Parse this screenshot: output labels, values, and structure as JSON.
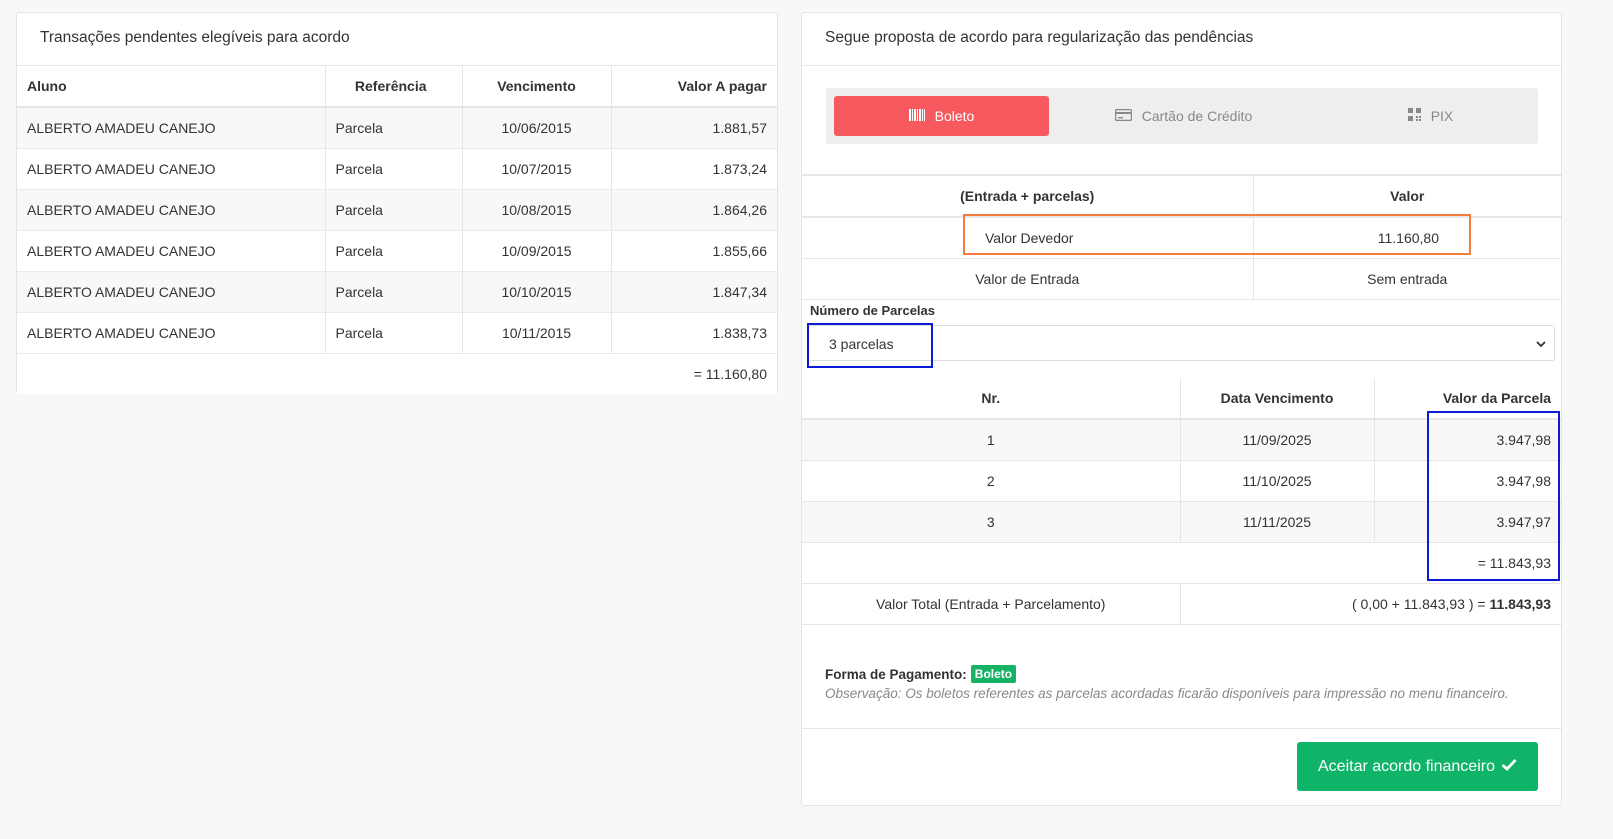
{
  "left_card": {
    "title": "Transações pendentes elegíveis para acordo",
    "columns": [
      "Aluno",
      "Referência",
      "Vencimento",
      "Valor A pagar"
    ],
    "rows": [
      {
        "aluno": "ALBERTO AMADEU CANEJO",
        "referencia": "Parcela",
        "vencimento": "10/06/2015",
        "valor": "1.881,57"
      },
      {
        "aluno": "ALBERTO AMADEU CANEJO",
        "referencia": "Parcela",
        "vencimento": "10/07/2015",
        "valor": "1.873,24"
      },
      {
        "aluno": "ALBERTO AMADEU CANEJO",
        "referencia": "Parcela",
        "vencimento": "10/08/2015",
        "valor": "1.864,26"
      },
      {
        "aluno": "ALBERTO AMADEU CANEJO",
        "referencia": "Parcela",
        "vencimento": "10/09/2015",
        "valor": "1.855,66"
      },
      {
        "aluno": "ALBERTO AMADEU CANEJO",
        "referencia": "Parcela",
        "vencimento": "10/10/2015",
        "valor": "1.847,34"
      },
      {
        "aluno": "ALBERTO AMADEU CANEJO",
        "referencia": "Parcela",
        "vencimento": "10/11/2015",
        "valor": "1.838,73"
      }
    ],
    "total": "= 11.160,80"
  },
  "right_card": {
    "title": "Segue proposta de acordo para regularização das pendências",
    "tabs": [
      {
        "label": "Boleto",
        "active": true
      },
      {
        "label": "Cartão de Crédito",
        "active": false
      },
      {
        "label": "PIX",
        "active": false
      }
    ],
    "summary": {
      "col1": "(Entrada + parcelas)",
      "col2": "Valor",
      "valor_devedor_label": "Valor Devedor",
      "valor_devedor": "11.160,80",
      "entrada_label": "Valor de Entrada",
      "entrada_value": "Sem entrada"
    },
    "parcelas": {
      "label": "Número de Parcelas",
      "selected": "3 parcelas"
    },
    "installments": {
      "columns": [
        "Nr.",
        "Data Vencimento",
        "Valor da Parcela"
      ],
      "rows": [
        {
          "nr": "1",
          "data": "11/09/2025",
          "valor": "3.947,98"
        },
        {
          "nr": "2",
          "data": "11/10/2025",
          "valor": "3.947,98"
        },
        {
          "nr": "3",
          "data": "11/11/2025",
          "valor": "3.947,97"
        }
      ],
      "sum": "= 11.843,93",
      "total_label": "Valor Total (Entrada + Parcelamento)",
      "total_expr": "( 0,00 + 11.843,93 ) = ",
      "total_value": "11.843,93"
    },
    "payment": {
      "label": "Forma de Pagamento:",
      "badge": "Boleto",
      "observacao": "Observação: Os boletos referentes as parcelas acordadas ficarão disponíveis para impressão no menu financeiro."
    },
    "accept_button": "Aceitar acordo financeiro"
  },
  "colors": {
    "active_tab": "#f65a5f",
    "accept_button": "#0fb469",
    "badge": "#18b265",
    "highlight_orange": "#f47c3c",
    "highlight_blue": "#0b1bd6"
  }
}
